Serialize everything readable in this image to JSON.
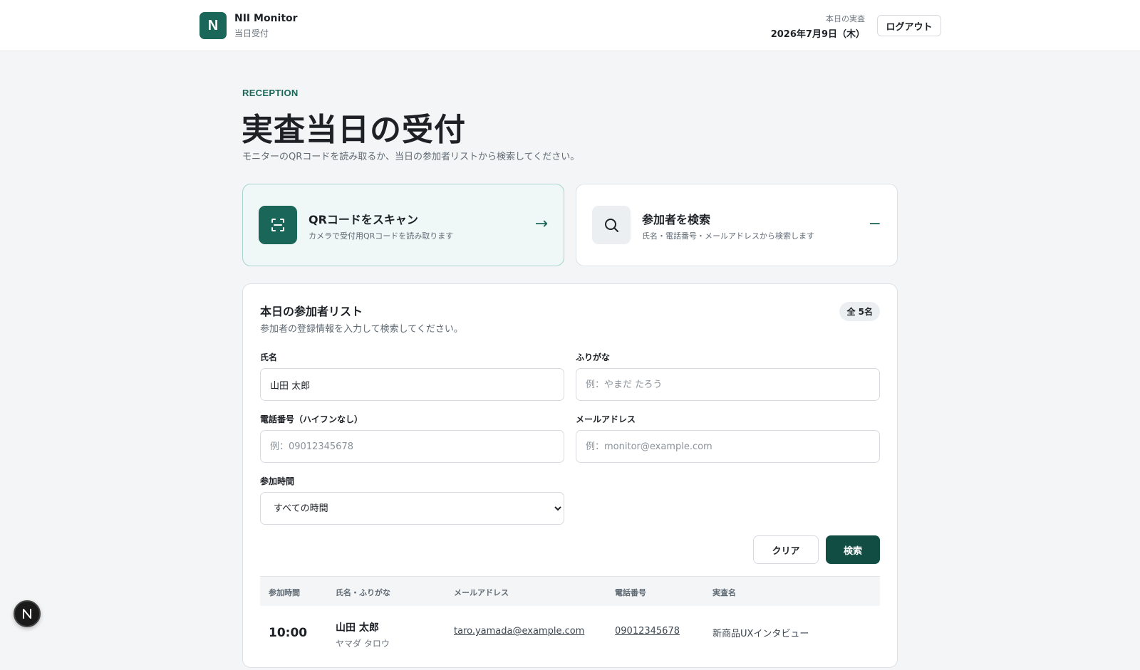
{
  "header": {
    "logo_letter": "N",
    "app_name": "NII Monitor",
    "app_sub": "当日受付",
    "today_label": "本日の実査",
    "today_date": "2026年7月9日（木）",
    "logout_label": "ログアウト"
  },
  "hero": {
    "eyebrow": "RECEPTION",
    "title": "実査当日の受付",
    "description": "モニターのQRコードを読み取るか、当日の参加者リストから検索してください。"
  },
  "actions": {
    "scan": {
      "title": "QRコードをスキャン",
      "subtitle": "カメラで受付用QRコードを読み取ります",
      "arrow": "→",
      "icon": "qr-scan-icon"
    },
    "search": {
      "title": "参加者を検索",
      "subtitle": "氏名・電話番号・メールアドレスから検索します",
      "toggle": "−",
      "icon": "search-icon"
    }
  },
  "list": {
    "title": "本日の参加者リスト",
    "description": "参加者の登録情報を入力して検索してください。",
    "count_badge": "全 5名",
    "form": {
      "name_label": "氏名",
      "name_value": "山田 太郎",
      "kana_label": "ふりがな",
      "kana_placeholder": "例：やまだ たろう",
      "phone_label": "電話番号（ハイフンなし）",
      "phone_placeholder": "例：09012345678",
      "email_label": "メールアドレス",
      "email_placeholder": "例：monitor@example.com",
      "time_label": "参加時間",
      "time_selected": "すべての時間"
    },
    "clear_label": "クリア",
    "search_label": "検索",
    "columns": [
      "参加時間",
      "氏名・ふりがな",
      "メールアドレス",
      "電話番号",
      "実査名"
    ],
    "rows": [
      {
        "time": "10:00",
        "name": "山田 太郎",
        "kana": "ヤマダ タロウ",
        "email": "taro.yamada@example.com",
        "phone": "09012345678",
        "study": "新商品UXインタビュー"
      }
    ]
  },
  "colors": {
    "brand": "#1a6659",
    "brand_dark": "#124d44",
    "scan_card_bg": "#eff8f6"
  }
}
